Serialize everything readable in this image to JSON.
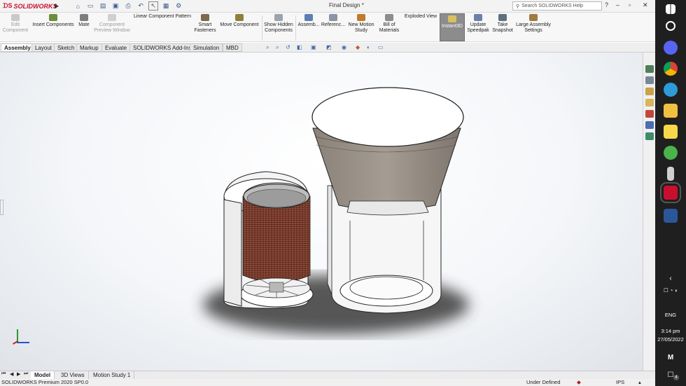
{
  "app": {
    "logo_text": "SOLIDWORKS",
    "document_title": "Final Design *",
    "search_placeholder": "Search SOLIDWORKS Help"
  },
  "commands": [
    {
      "label": "Edit Component",
      "disabled": true
    },
    {
      "label": "Insert Components",
      "disabled": false
    },
    {
      "label": "Mate",
      "disabled": false
    },
    {
      "label": "Component Preview Window",
      "disabled": true
    },
    {
      "label": "Linear Component Pattern",
      "disabled": false
    },
    {
      "label": "Smart Fasteners",
      "disabled": false
    },
    {
      "label": "Move Component",
      "disabled": false
    },
    {
      "label": "Show Hidden Components",
      "disabled": false
    },
    {
      "label": "Assemb...",
      "disabled": false
    },
    {
      "label": "Referenc...",
      "disabled": false
    },
    {
      "label": "New Motion Study",
      "disabled": false
    },
    {
      "label": "Bill of Materials",
      "disabled": false
    },
    {
      "label": "Exploded View",
      "disabled": false
    },
    {
      "label": "Instant3D",
      "disabled": false,
      "active": true
    },
    {
      "label": "Update Speedpak",
      "disabled": false
    },
    {
      "label": "Take Snapshot",
      "disabled": false
    },
    {
      "label": "Large Assembly Settings",
      "disabled": false
    }
  ],
  "tabs": [
    "Assembly",
    "Layout",
    "Sketch",
    "Markup",
    "Evaluate",
    "SOLIDWORKS Add-Ins",
    "Simulation",
    "MBD"
  ],
  "bottom_tabs": [
    "Model",
    "3D Views",
    "Motion Study 1"
  ],
  "status": {
    "left": "SOLIDWORKS Premium 2020 SP0.0",
    "state": "Under Defined",
    "units": "IPS"
  },
  "taskbar": {
    "lang": "ENG",
    "time": "3:14 pm",
    "date": "27/05/2022",
    "notification_count": "4"
  },
  "colors": {
    "accent": "#c8102e",
    "coil": "#8b4a3a",
    "hopper": "#9a9088"
  }
}
